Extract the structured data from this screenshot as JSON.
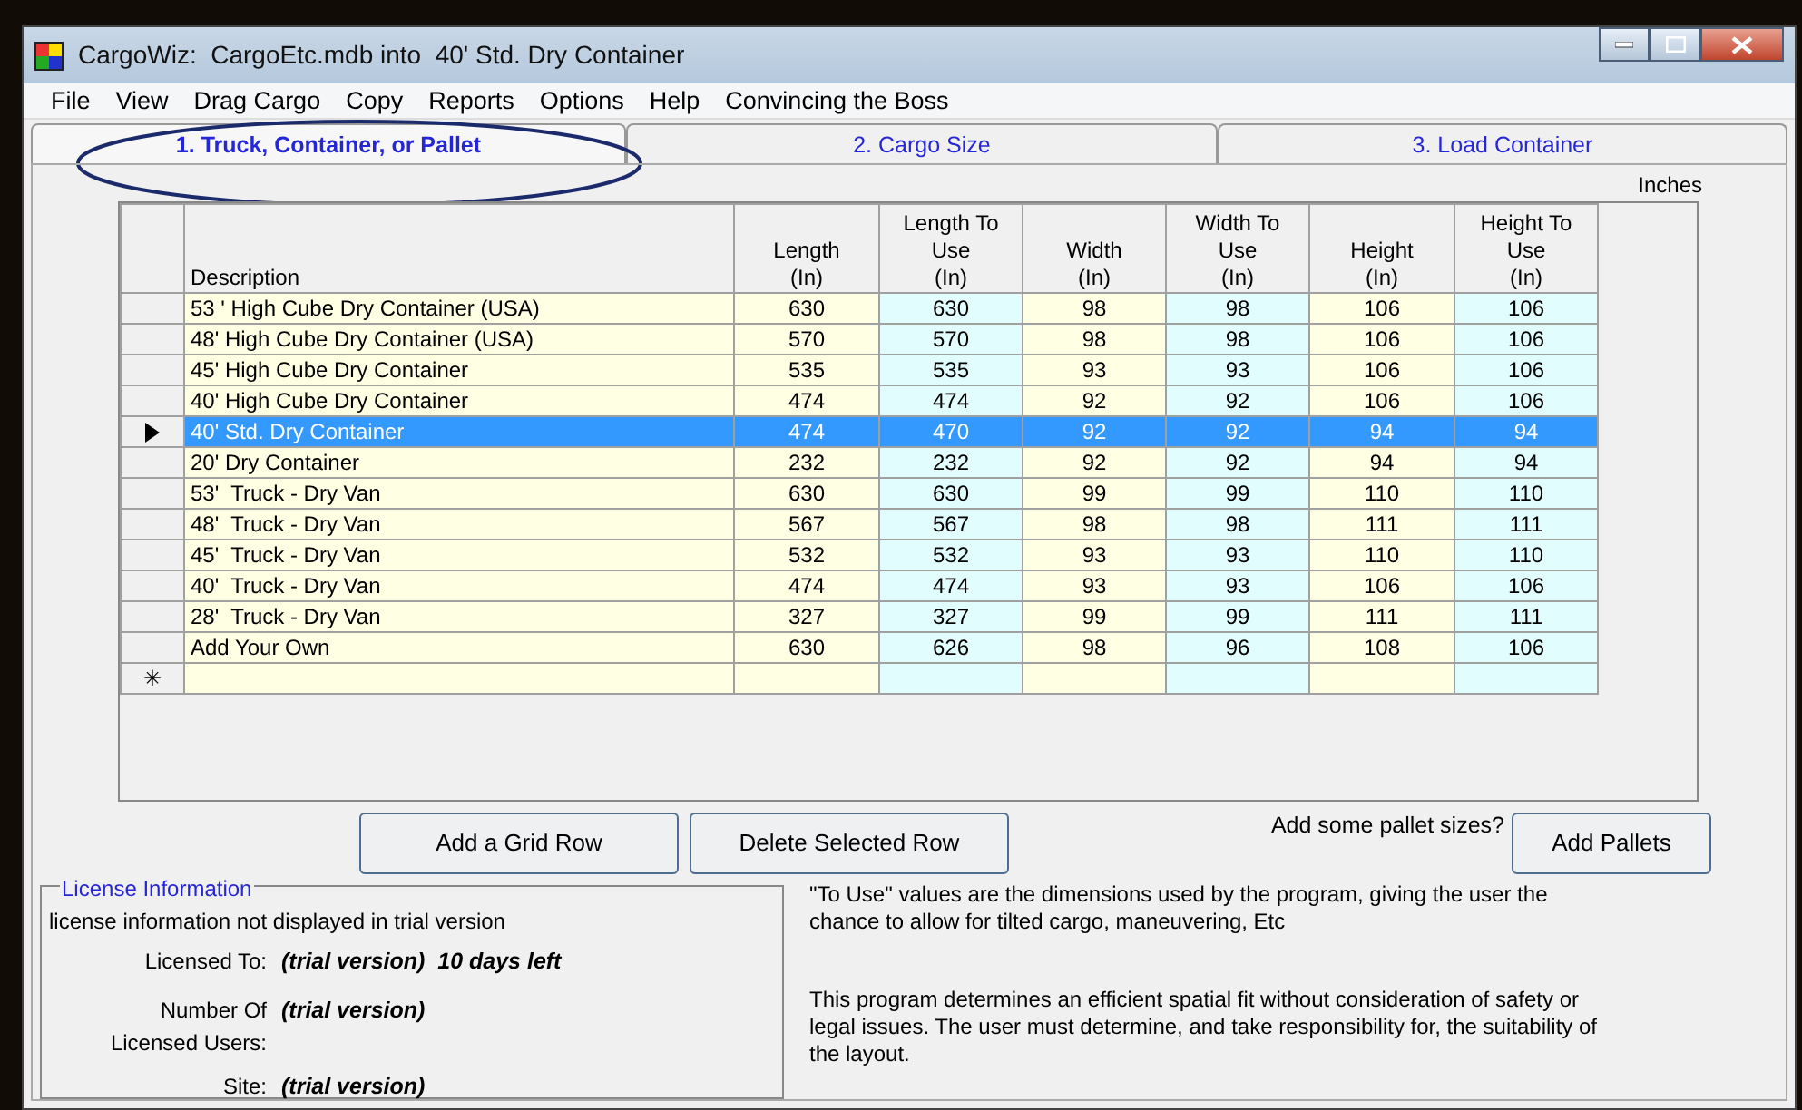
{
  "window": {
    "title": "CargoWiz:  CargoEtc.mdb into  40' Std. Dry Container"
  },
  "menu": [
    "File",
    "View",
    "Drag Cargo",
    "Copy",
    "Reports",
    "Options",
    "Help",
    "Convincing the Boss"
  ],
  "tabs": [
    {
      "label": "1. Truck, Container, or Pallet",
      "selected": true,
      "circled": true
    },
    {
      "label": "2. Cargo Size",
      "selected": false,
      "circled": false
    },
    {
      "label": "3. Load Container",
      "selected": false,
      "circled": false
    }
  ],
  "units_label": "Inches",
  "table": {
    "columns": [
      {
        "heading": [
          "Description"
        ],
        "kind": "text"
      },
      {
        "heading": [
          "Length",
          "(In)"
        ],
        "kind": "measure"
      },
      {
        "heading": [
          "Length To",
          "Use",
          "(In)"
        ],
        "kind": "to_use"
      },
      {
        "heading": [
          "Width",
          "(In)"
        ],
        "kind": "measure"
      },
      {
        "heading": [
          "Width To",
          "Use",
          "(In)"
        ],
        "kind": "to_use"
      },
      {
        "heading": [
          "Height",
          "(In)"
        ],
        "kind": "measure"
      },
      {
        "heading": [
          "Height To",
          "Use",
          "(In)"
        ],
        "kind": "to_use"
      }
    ],
    "rows": [
      {
        "cells": [
          "53 ' High Cube Dry Container (USA)",
          "630",
          "630",
          "98",
          "98",
          "106",
          "106"
        ],
        "selected": false
      },
      {
        "cells": [
          "48' High Cube Dry Container (USA)",
          "570",
          "570",
          "98",
          "98",
          "106",
          "106"
        ],
        "selected": false
      },
      {
        "cells": [
          "45' High Cube Dry Container",
          "535",
          "535",
          "93",
          "93",
          "106",
          "106"
        ],
        "selected": false
      },
      {
        "cells": [
          "40' High Cube Dry Container",
          "474",
          "474",
          "92",
          "92",
          "106",
          "106"
        ],
        "selected": false
      },
      {
        "cells": [
          "40' Std. Dry Container",
          "474",
          "470",
          "92",
          "92",
          "94",
          "94"
        ],
        "selected": true
      },
      {
        "cells": [
          "20' Dry Container",
          "232",
          "232",
          "92",
          "92",
          "94",
          "94"
        ],
        "selected": false
      },
      {
        "cells": [
          "53'  Truck - Dry Van",
          "630",
          "630",
          "99",
          "99",
          "110",
          "110"
        ],
        "selected": false
      },
      {
        "cells": [
          "48'  Truck - Dry Van",
          "567",
          "567",
          "98",
          "98",
          "111",
          "111"
        ],
        "selected": false
      },
      {
        "cells": [
          "45'  Truck - Dry Van",
          "532",
          "532",
          "93",
          "93",
          "110",
          "110"
        ],
        "selected": false
      },
      {
        "cells": [
          "40'  Truck - Dry Van",
          "474",
          "474",
          "93",
          "93",
          "106",
          "106"
        ],
        "selected": false
      },
      {
        "cells": [
          "28'  Truck - Dry Van",
          "327",
          "327",
          "99",
          "99",
          "111",
          "111"
        ],
        "selected": false
      },
      {
        "cells": [
          "Add Your Own",
          "630",
          "626",
          "98",
          "96",
          "108",
          "106"
        ],
        "selected": false
      }
    ],
    "new_row_marker": "✳"
  },
  "buttons": [
    "Add a Grid Row",
    "Delete Selected Row"
  ],
  "pallet_prompt": "Add some pallet sizes?",
  "pallet_button": "Add Pallets",
  "license": {
    "legend": "License Information",
    "note": "license information not displayed in trial version",
    "fields": [
      {
        "label": "Licensed To:",
        "value": "(trial version)  10 days left"
      },
      {
        "label": "Number Of Licensed Users:",
        "value": "(trial version)"
      },
      {
        "label": "Site:",
        "value": "(trial version)"
      }
    ]
  },
  "notes": [
    "\"To Use\" values are the dimensions used by the program, giving the user the chance to allow  for tilted cargo, maneuvering, Etc",
    "This program determines an efficient spatial fit without consideration of safety or legal issues. The user must determine, and take responsibility for, the suitability of the layout."
  ]
}
